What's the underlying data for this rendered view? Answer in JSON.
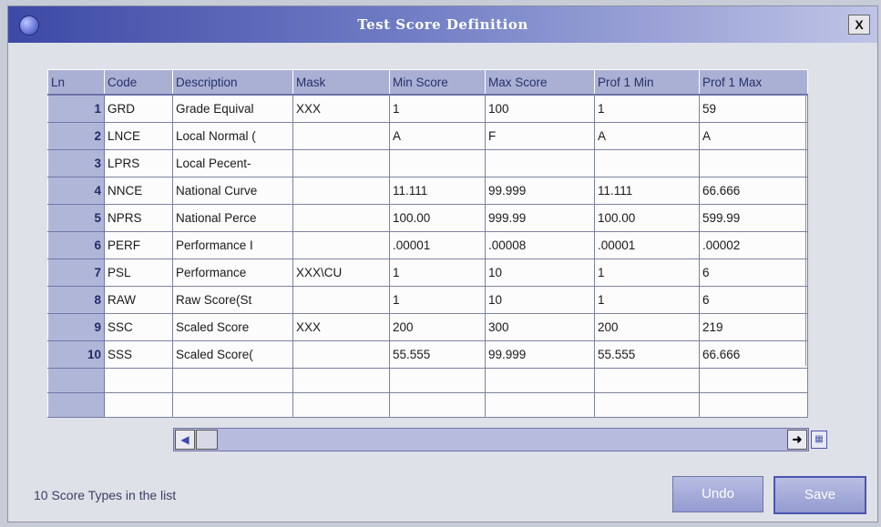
{
  "window": {
    "title": "Test Score Definition",
    "close_label": "X"
  },
  "grid": {
    "columns": [
      "Ln",
      "Code",
      "Description",
      "Mask",
      "Min Score",
      "Max Score",
      "Prof 1 Min",
      "Prof 1 Max"
    ],
    "rows": [
      {
        "ln": "1",
        "code": "GRD",
        "description": "Grade Equival",
        "mask": "XXX",
        "min": "1",
        "max": "100",
        "p1min": "1",
        "p1max": "59"
      },
      {
        "ln": "2",
        "code": "LNCE",
        "description": "Local Normal (",
        "mask": "",
        "min": "A",
        "max": "F",
        "p1min": "A",
        "p1max": "A"
      },
      {
        "ln": "3",
        "code": "LPRS",
        "description": "Local Pecent-",
        "mask": "",
        "min": "",
        "max": "",
        "p1min": "",
        "p1max": ""
      },
      {
        "ln": "4",
        "code": "NNCE",
        "description": "National Curve",
        "mask": "",
        "min": "11.111",
        "max": "99.999",
        "p1min": "11.111",
        "p1max": "66.666"
      },
      {
        "ln": "5",
        "code": "NPRS",
        "description": "National Perce",
        "mask": "",
        "min": "100.00",
        "max": "999.99",
        "p1min": "100.00",
        "p1max": "599.99"
      },
      {
        "ln": "6",
        "code": "PERF",
        "description": "Performance I",
        "mask": "",
        "min": ".00001",
        "max": ".00008",
        "p1min": ".00001",
        "p1max": ".00002"
      },
      {
        "ln": "7",
        "code": "PSL",
        "description": "Performance",
        "mask": "XXX\\CU",
        "min": "1",
        "max": "10",
        "p1min": "1",
        "p1max": "6"
      },
      {
        "ln": "8",
        "code": "RAW",
        "description": "Raw Score(St",
        "mask": "",
        "min": "1",
        "max": "10",
        "p1min": "1",
        "p1max": "6"
      },
      {
        "ln": "9",
        "code": "SSC",
        "description": "Scaled Score",
        "mask": "XXX",
        "min": "200",
        "max": "300",
        "p1min": "200",
        "p1max": "219"
      },
      {
        "ln": "10",
        "code": "SSS",
        "description": "Scaled Score(",
        "mask": "",
        "min": "55.555",
        "max": "99.999",
        "p1min": "55.555",
        "p1max": "66.666"
      }
    ]
  },
  "status_text": "10  Score Types in the list",
  "buttons": {
    "undo": "Undo",
    "save": "Save"
  },
  "colors": {
    "title_bar": "#3d4aa5",
    "header_bg": "#aab0d4",
    "row_header_bg": "#b0b6d8"
  }
}
